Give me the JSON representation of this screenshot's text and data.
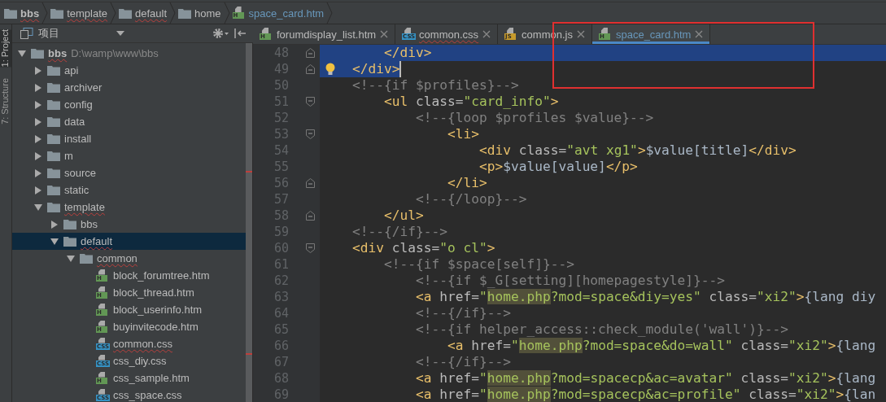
{
  "breadcrumbs": [
    {
      "kind": "folder",
      "label": "bbs",
      "bold": true,
      "typo": true
    },
    {
      "kind": "folder",
      "label": "template",
      "bold": false,
      "typo": true
    },
    {
      "kind": "folder",
      "label": "default",
      "bold": false,
      "typo": true
    },
    {
      "kind": "folder",
      "label": "home",
      "bold": false,
      "typo": false
    },
    {
      "kind": "file",
      "label": "space_card.htm",
      "bold": false,
      "typo": false,
      "badge": "H",
      "color": "#629755"
    }
  ],
  "tool_strip": [
    {
      "label": "1: Project",
      "selected": true
    },
    {
      "label": "7: Structure",
      "selected": false
    }
  ],
  "project_panel": {
    "title": "项目",
    "tree": [
      {
        "kind": "folder",
        "label": "bbs",
        "path": "D:\\wamp\\www\\bbs",
        "expanded": true,
        "selected": false,
        "typo": true,
        "children": [
          {
            "kind": "folder",
            "label": "api",
            "expanded": false,
            "selected": false,
            "typo": false
          },
          {
            "kind": "folder",
            "label": "archiver",
            "expanded": false,
            "selected": false,
            "typo": false
          },
          {
            "kind": "folder",
            "label": "config",
            "expanded": false,
            "selected": false,
            "typo": false
          },
          {
            "kind": "folder",
            "label": "data",
            "expanded": false,
            "selected": false,
            "typo": false
          },
          {
            "kind": "folder",
            "label": "install",
            "expanded": false,
            "selected": false,
            "typo": false
          },
          {
            "kind": "folder",
            "label": "m",
            "expanded": false,
            "selected": false,
            "typo": false
          },
          {
            "kind": "folder",
            "label": "source",
            "expanded": false,
            "selected": false,
            "typo": false
          },
          {
            "kind": "folder",
            "label": "static",
            "expanded": false,
            "selected": false,
            "typo": false
          },
          {
            "kind": "folder",
            "label": "template",
            "expanded": true,
            "selected": false,
            "typo": true,
            "children": [
              {
                "kind": "folder",
                "label": "bbs",
                "expanded": false,
                "selected": false,
                "typo": false
              },
              {
                "kind": "folder",
                "label": "default",
                "expanded": true,
                "selected": true,
                "typo": true,
                "children": [
                  {
                    "kind": "folder",
                    "label": "common",
                    "expanded": true,
                    "selected": false,
                    "typo": true,
                    "children": [
                      {
                        "kind": "file",
                        "label": "block_forumtree.htm",
                        "badge": "H",
                        "color": "#629755",
                        "selected": false,
                        "typo": false
                      },
                      {
                        "kind": "file",
                        "label": "block_thread.htm",
                        "badge": "H",
                        "color": "#629755",
                        "selected": false,
                        "typo": false
                      },
                      {
                        "kind": "file",
                        "label": "block_userinfo.htm",
                        "badge": "H",
                        "color": "#629755",
                        "selected": false,
                        "typo": false
                      },
                      {
                        "kind": "file",
                        "label": "buyinvitecode.htm",
                        "badge": "H",
                        "color": "#629755",
                        "selected": false,
                        "typo": false
                      },
                      {
                        "kind": "file",
                        "label": "common.css",
                        "badge": "CSS",
                        "color": "#3592c4",
                        "selected": false,
                        "typo": true
                      },
                      {
                        "kind": "file",
                        "label": "css_diy.css",
                        "badge": "CSS",
                        "color": "#3592c4",
                        "selected": false,
                        "typo": false
                      },
                      {
                        "kind": "file",
                        "label": "css_sample.htm",
                        "badge": "H",
                        "color": "#629755",
                        "selected": false,
                        "typo": false
                      },
                      {
                        "kind": "file",
                        "label": "css_space.css",
                        "badge": "CSS",
                        "color": "#3592c4",
                        "selected": false,
                        "typo": false
                      }
                    ]
                  }
                ]
              }
            ]
          }
        ]
      }
    ]
  },
  "tabs": [
    {
      "label": "forumdisplay_list.htm",
      "badge": "H",
      "color": "#629755",
      "selected": false,
      "typo": false
    },
    {
      "label": "common.css",
      "badge": "CSS",
      "color": "#3592c4",
      "selected": false,
      "typo": true
    },
    {
      "label": "common.js",
      "badge": "JS",
      "color": "#c69a2c",
      "selected": false,
      "typo": false
    },
    {
      "label": "space_card.htm",
      "badge": "H",
      "color": "#629755",
      "selected": true,
      "typo": false
    }
  ],
  "code_lines": [
    {
      "n": "48",
      "selected": true,
      "fold_start": false,
      "fold_end": true,
      "bulb": false,
      "caret": false,
      "tokens": [
        {
          "kind": "tag",
          "text": "    </div>"
        }
      ]
    },
    {
      "n": "49",
      "selected": true,
      "fold_start": false,
      "fold_end": true,
      "bulb": true,
      "caret": true,
      "tokens": [
        {
          "kind": "tag",
          "text": "</div>"
        }
      ]
    },
    {
      "n": "50",
      "selected": false,
      "fold_start": false,
      "fold_end": false,
      "bulb": false,
      "caret": false,
      "tokens": [
        {
          "kind": "comment",
          "text": "<!--{if $profiles}-->"
        }
      ]
    },
    {
      "n": "51",
      "selected": false,
      "fold_start": true,
      "fold_end": false,
      "bulb": false,
      "caret": false,
      "tokens": [
        {
          "kind": "tag",
          "text": "    <ul "
        },
        {
          "kind": "attr",
          "text": "class="
        },
        {
          "kind": "str",
          "text": "\"card_info\""
        },
        {
          "kind": "tag",
          "text": ">"
        }
      ]
    },
    {
      "n": "52",
      "selected": false,
      "fold_start": false,
      "fold_end": false,
      "bulb": false,
      "caret": false,
      "tokens": [
        {
          "kind": "comment",
          "text": "        <!--{loop $profiles $value}-->"
        }
      ]
    },
    {
      "n": "53",
      "selected": false,
      "fold_start": true,
      "fold_end": false,
      "bulb": false,
      "caret": false,
      "tokens": [
        {
          "kind": "tag",
          "text": "            <li>"
        }
      ]
    },
    {
      "n": "54",
      "selected": false,
      "fold_start": false,
      "fold_end": false,
      "bulb": false,
      "caret": false,
      "tokens": [
        {
          "kind": "tag",
          "text": "                <div "
        },
        {
          "kind": "attr",
          "text": "class="
        },
        {
          "kind": "str",
          "text": "\"avt xg1\""
        },
        {
          "kind": "tag",
          "text": ">"
        },
        {
          "kind": "text",
          "text": "$value[title]"
        },
        {
          "kind": "tag",
          "text": "</div>"
        }
      ]
    },
    {
      "n": "55",
      "selected": false,
      "fold_start": false,
      "fold_end": false,
      "bulb": false,
      "caret": false,
      "tokens": [
        {
          "kind": "tag",
          "text": "                <p>"
        },
        {
          "kind": "text",
          "text": "$value[value]"
        },
        {
          "kind": "tag",
          "text": "</p>"
        }
      ]
    },
    {
      "n": "56",
      "selected": false,
      "fold_start": false,
      "fold_end": true,
      "bulb": false,
      "caret": false,
      "tokens": [
        {
          "kind": "tag",
          "text": "            </li>"
        }
      ]
    },
    {
      "n": "57",
      "selected": false,
      "fold_start": false,
      "fold_end": false,
      "bulb": false,
      "caret": false,
      "tokens": [
        {
          "kind": "comment",
          "text": "        <!--{/loop}-->"
        }
      ]
    },
    {
      "n": "58",
      "selected": false,
      "fold_start": false,
      "fold_end": true,
      "bulb": false,
      "caret": false,
      "tokens": [
        {
          "kind": "tag",
          "text": "    </ul>"
        }
      ]
    },
    {
      "n": "59",
      "selected": false,
      "fold_start": false,
      "fold_end": false,
      "bulb": false,
      "caret": false,
      "tokens": [
        {
          "kind": "comment",
          "text": "<!--{/if}-->"
        }
      ]
    },
    {
      "n": "60",
      "selected": false,
      "fold_start": true,
      "fold_end": false,
      "bulb": false,
      "caret": false,
      "tokens": [
        {
          "kind": "tag",
          "text": "<div "
        },
        {
          "kind": "attr",
          "text": "class="
        },
        {
          "kind": "str",
          "text": "\"o cl\""
        },
        {
          "kind": "tag",
          "text": ">"
        }
      ]
    },
    {
      "n": "61",
      "selected": false,
      "fold_start": false,
      "fold_end": false,
      "bulb": false,
      "caret": false,
      "tokens": [
        {
          "kind": "comment",
          "text": "    <!--{if $space[self]}-->"
        }
      ]
    },
    {
      "n": "62",
      "selected": false,
      "fold_start": false,
      "fold_end": false,
      "bulb": false,
      "caret": false,
      "tokens": [
        {
          "kind": "comment",
          "text": "        <!--{if $_G[setting][homepagestyle]}-->"
        }
      ]
    },
    {
      "n": "63",
      "selected": false,
      "fold_start": false,
      "fold_end": false,
      "bulb": false,
      "caret": false,
      "tokens": [
        {
          "kind": "tag",
          "text": "        <a "
        },
        {
          "kind": "attr",
          "text": "href="
        },
        {
          "kind": "str",
          "text": "\""
        },
        {
          "kind": "hl",
          "text": "home.php"
        },
        {
          "kind": "str",
          "text": "?mod=space&diy=yes\""
        },
        {
          "kind": "attr",
          "text": " class="
        },
        {
          "kind": "str",
          "text": "\"xi2\""
        },
        {
          "kind": "tag",
          "text": ">"
        },
        {
          "kind": "text",
          "text": "{lang diy"
        }
      ]
    },
    {
      "n": "64",
      "selected": false,
      "fold_start": false,
      "fold_end": false,
      "bulb": false,
      "caret": false,
      "tokens": [
        {
          "kind": "comment",
          "text": "        <!--{/if}-->"
        }
      ]
    },
    {
      "n": "65",
      "selected": false,
      "fold_start": false,
      "fold_end": false,
      "bulb": false,
      "caret": false,
      "tokens": [
        {
          "kind": "comment",
          "text": "        <!--{if helper_access::check_module('wall')}-->"
        }
      ]
    },
    {
      "n": "66",
      "selected": false,
      "fold_start": false,
      "fold_end": false,
      "bulb": false,
      "caret": false,
      "tokens": [
        {
          "kind": "tag",
          "text": "            <a "
        },
        {
          "kind": "attr",
          "text": "href="
        },
        {
          "kind": "str",
          "text": "\""
        },
        {
          "kind": "hl",
          "text": "home.php"
        },
        {
          "kind": "str",
          "text": "?mod=space&do=wall\""
        },
        {
          "kind": "attr",
          "text": " class="
        },
        {
          "kind": "str",
          "text": "\"xi2\""
        },
        {
          "kind": "tag",
          "text": ">"
        },
        {
          "kind": "text",
          "text": "{lang"
        }
      ]
    },
    {
      "n": "67",
      "selected": false,
      "fold_start": false,
      "fold_end": false,
      "bulb": false,
      "caret": false,
      "tokens": [
        {
          "kind": "comment",
          "text": "        <!--{/if}-->"
        }
      ]
    },
    {
      "n": "68",
      "selected": false,
      "fold_start": false,
      "fold_end": false,
      "bulb": false,
      "caret": false,
      "tokens": [
        {
          "kind": "tag",
          "text": "        <a "
        },
        {
          "kind": "attr",
          "text": "href="
        },
        {
          "kind": "str",
          "text": "\""
        },
        {
          "kind": "hl",
          "text": "home.php"
        },
        {
          "kind": "str",
          "text": "?mod=spacecp&ac=avatar\""
        },
        {
          "kind": "attr",
          "text": " class="
        },
        {
          "kind": "str",
          "text": "\"xi2\""
        },
        {
          "kind": "tag",
          "text": ">"
        },
        {
          "kind": "text",
          "text": "{lang"
        }
      ]
    },
    {
      "n": "69",
      "selected": false,
      "fold_start": false,
      "fold_end": false,
      "bulb": false,
      "caret": false,
      "tokens": [
        {
          "kind": "tag",
          "text": "        <a "
        },
        {
          "kind": "attr",
          "text": "href="
        },
        {
          "kind": "str",
          "text": "\""
        },
        {
          "kind": "hl",
          "text": "home.php"
        },
        {
          "kind": "str",
          "text": "?mod=spacecp&ac=profile\""
        },
        {
          "kind": "attr",
          "text": " class="
        },
        {
          "kind": "str",
          "text": "\"xi2\""
        },
        {
          "kind": "tag",
          "text": ">"
        },
        {
          "kind": "text",
          "text": "{lan"
        }
      ]
    }
  ]
}
